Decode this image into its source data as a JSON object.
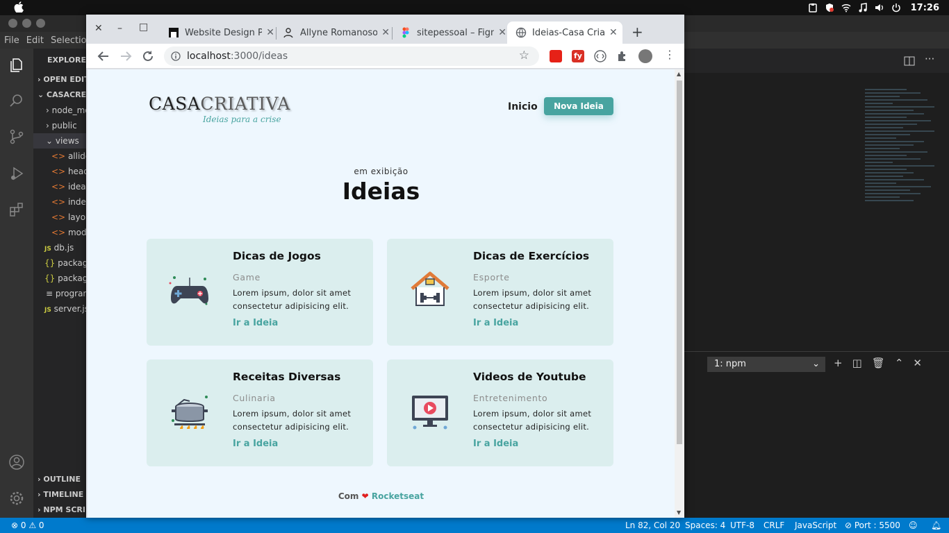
{
  "os": {
    "apple_symbol": "",
    "clock": "17:26",
    "tray_icons": [
      "clipboard-icon",
      "shield-icon",
      "wifi-icon",
      "music-icon",
      "volume-icon",
      "power-icon"
    ]
  },
  "vscode": {
    "menu": [
      "File",
      "Edit",
      "Selection"
    ],
    "explorer_title": "EXPLORER",
    "open_editors": "OPEN EDITORS",
    "project": "CASACREATIVA",
    "tree": [
      {
        "label": "node_modules",
        "kind": "folder"
      },
      {
        "label": "public",
        "kind": "folder"
      },
      {
        "label": "views",
        "kind": "folder-open"
      },
      {
        "label": "allideas.html",
        "kind": "html"
      },
      {
        "label": "head.html",
        "kind": "html"
      },
      {
        "label": "ideas.html",
        "kind": "html"
      },
      {
        "label": "index.html",
        "kind": "html"
      },
      {
        "label": "layout.html",
        "kind": "html"
      },
      {
        "label": "modal.html",
        "kind": "html"
      },
      {
        "label": "db.js",
        "kind": "js"
      },
      {
        "label": "package.json",
        "kind": "json"
      },
      {
        "label": "package-lock.json",
        "kind": "json"
      },
      {
        "label": "programming.txt",
        "kind": "txt"
      },
      {
        "label": "server.js",
        "kind": "js"
      }
    ],
    "bottom_sections": [
      "OUTLINE",
      "TIMELINE",
      "NPM SCRIPTS"
    ],
    "terminal_select": "1: npm",
    "status": {
      "errors": "0",
      "warnings": "0",
      "position": "Ln 82, Col 20",
      "spaces": "Spaces: 4",
      "encoding": "UTF-8",
      "eol": "CRLF",
      "language": "JavaScript",
      "port": "Port : 5500"
    }
  },
  "browser": {
    "tabs": [
      {
        "title": "Website Design Pro",
        "active": false
      },
      {
        "title": "Allyne Romanosoares",
        "active": false
      },
      {
        "title": "sitepessoal – Figma",
        "active": false
      },
      {
        "title": "Ideias-Casa Criativa",
        "active": true
      }
    ],
    "url_host": "localhost",
    "url_path": ":3000/ideas"
  },
  "page": {
    "logo_main": "CASA",
    "logo_bold": "CRIATIVA",
    "logo_tagline": "Ideias para a crise",
    "nav_home": "Inicio",
    "nav_new": "Nova Ideia",
    "subtitle": "em exibição",
    "title": "Ideias",
    "cards": [
      {
        "title": "Dicas de Jogos",
        "category": "Game",
        "description": "Lorem ipsum, dolor sit amet consectetur adipisicing elit.",
        "link": "Ir a Ideia",
        "icon": "gamepad-icon"
      },
      {
        "title": "Dicas de Exercícios",
        "category": "Esporte",
        "description": "Lorem ipsum, dolor sit amet consectetur adipisicing elit.",
        "link": "Ir a Ideia",
        "icon": "home-gym-icon"
      },
      {
        "title": "Receitas Diversas",
        "category": "Culinaria",
        "description": "Lorem ipsum, dolor sit amet consectetur adipisicing elit.",
        "link": "Ir a Ideia",
        "icon": "cooking-pot-icon"
      },
      {
        "title": "Videos de Youtube",
        "category": "Entretenimento",
        "description": "Lorem ipsum, dolor sit amet consectetur adipisicing elit.",
        "link": "Ir a Ideia",
        "icon": "video-monitor-icon"
      }
    ],
    "footer_prefix": "Com",
    "footer_heart": "❤",
    "footer_brand": "Rocketseat"
  },
  "colors": {
    "accent": "#48a4a0",
    "card_bg": "#dbeeee",
    "page_bg": "#eef7fe",
    "vscode_status": "#007acc"
  }
}
